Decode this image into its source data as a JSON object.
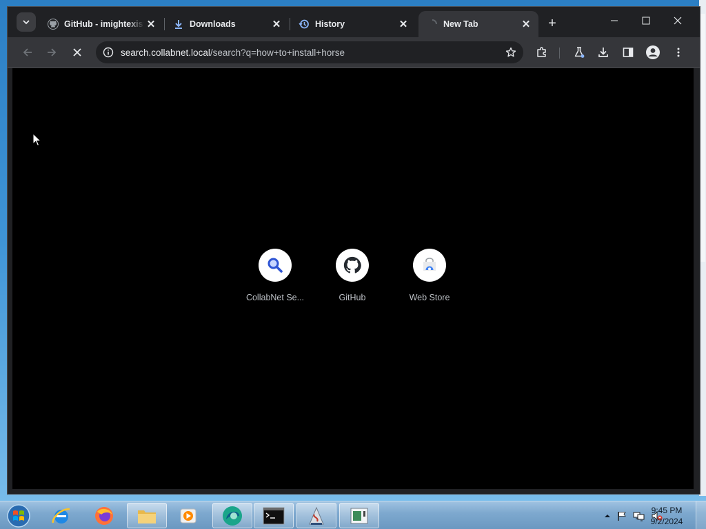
{
  "browser": {
    "tabs": [
      {
        "title": "GitHub - imightexist",
        "favicon": "github-icon",
        "active": false
      },
      {
        "title": "Downloads",
        "favicon": "download-icon",
        "active": false
      },
      {
        "title": "History",
        "favicon": "history-icon",
        "active": false
      },
      {
        "title": "New Tab",
        "favicon": "loading-spinner-icon",
        "active": true
      }
    ],
    "tab_close_glyph": "✕",
    "new_tab_glyph": "+",
    "window_controls": {
      "minimize": "—",
      "maximize": "☐",
      "close": "✕"
    },
    "address_bar": {
      "host": "search.collabnet.local",
      "path": "/search?q=how+to+install+horse"
    },
    "colors": {
      "tab_strip": "#202124",
      "toolbar": "#35363a",
      "omnibox": "#202124",
      "content": "#000000",
      "accent_blue": "#8ab4f8"
    }
  },
  "new_tab_page": {
    "shortcuts": [
      {
        "label": "CollabNet Se...",
        "icon": "search-magnifier-icon"
      },
      {
        "label": "GitHub",
        "icon": "github-icon"
      },
      {
        "label": "Web Store",
        "icon": "web-store-icon"
      }
    ]
  },
  "taskbar": {
    "pinned": [
      "start-orb-icon",
      "internet-explorer-icon",
      "firefox-icon",
      "file-explorer-icon",
      "media-player-icon",
      "browser-app-icon",
      "command-prompt-icon",
      "java-app-icon",
      "document-app-icon"
    ],
    "clock": {
      "time": "9:45 PM",
      "date": "9/2/2024"
    },
    "tray_icons": [
      "show-hidden-icons",
      "action-center-flag-icon",
      "network-icon",
      "volume-muted-icon"
    ]
  }
}
